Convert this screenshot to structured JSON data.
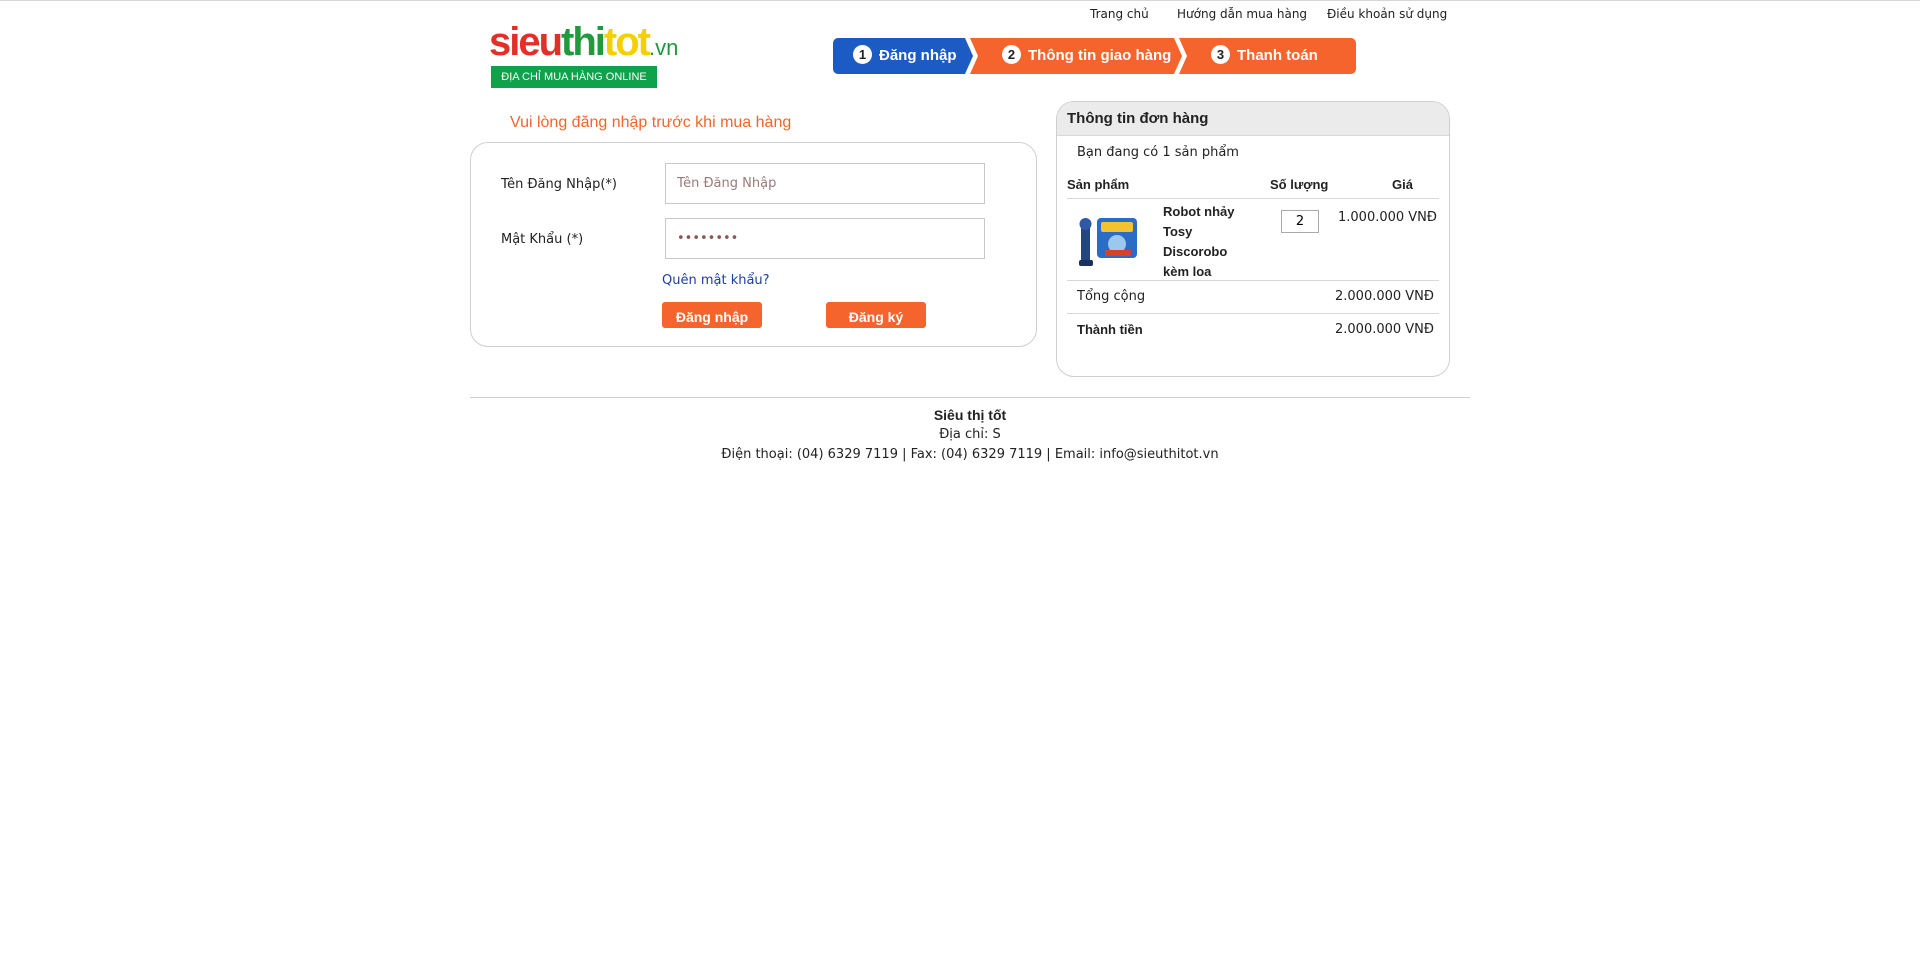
{
  "nav": {
    "links": [
      "Trang chủ",
      "Hướng dẫn mua hàng",
      "Điều khoản sử dụng"
    ]
  },
  "logo": {
    "part1": "sieu",
    "part2": "thi",
    "part3": "tot",
    "part4": ".vn",
    "tagline": "ĐỊA CHỈ MUA HÀNG ONLINE"
  },
  "steps": [
    {
      "num": "1",
      "label": "Đăng nhập",
      "color": "#1d5bc4"
    },
    {
      "num": "2",
      "label": "Thông tin giao hàng",
      "color": "#f5642c"
    },
    {
      "num": "3",
      "label": "Thanh toán",
      "color": "#f5642c"
    }
  ],
  "login": {
    "title": "Vui lòng đăng nhập trước khi mua hàng",
    "username_label": "Tên Đăng Nhập(*)",
    "username_placeholder": "Tên Đăng Nhập",
    "username_value": "",
    "password_label": "Mật Khẩu (*)",
    "password_value": "••••••••",
    "forgot": "Quên mật khẩu?",
    "login_button": "Đăng nhập",
    "register_button": "Đăng ký"
  },
  "order": {
    "title": "Thông tin đơn hàng",
    "count_text": "Bạn đang có 1 sản phẩm",
    "columns": {
      "product": "Sản phẩm",
      "quantity": "Số lượng",
      "price": "Giá"
    },
    "item": {
      "name": "Robot nhảy Tosy Discorobo kèm loa",
      "quantity": "2",
      "price": "1.000.000 VNĐ"
    },
    "subtotal_label": "Tổng cộng",
    "subtotal_value": "2.000.000 VNĐ",
    "total_label": "Thành tiền",
    "total_value": "2.000.000 VNĐ"
  },
  "footer": {
    "name": "Siêu thị tốt",
    "address": "Địa chỉ: S",
    "contact": "Điện thoại: (04) 6329 7119 | Fax: (04) 6329 7119 | Email: info@sieuthitot.vn"
  },
  "colors": {
    "accent_orange": "#f5642c",
    "step_blue": "#1d5bc4",
    "logo_red": "#e32f27",
    "logo_green": "#1f9a3c",
    "logo_yellow": "#f5d000",
    "link_blue": "#1b3fa0"
  }
}
